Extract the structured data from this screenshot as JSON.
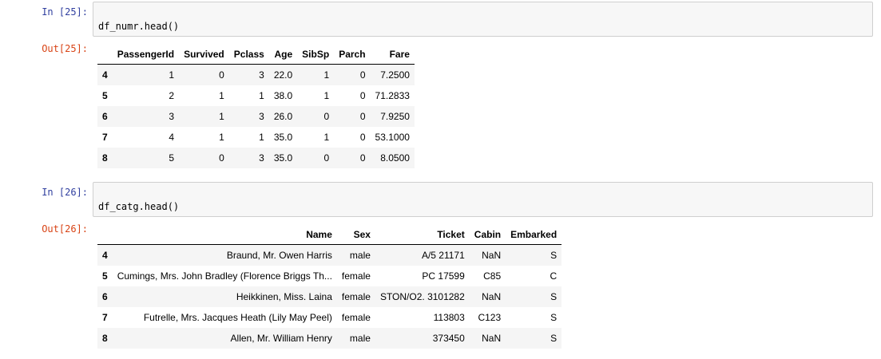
{
  "cells": [
    {
      "in_prompt": "In [25]:",
      "code": "df_numr.head()",
      "out_prompt": "Out[25]:",
      "table": {
        "columns": [
          "",
          "PassengerId",
          "Survived",
          "Pclass",
          "Age",
          "SibSp",
          "Parch",
          "Fare"
        ],
        "rows": [
          [
            "4",
            "1",
            "0",
            "3",
            "22.0",
            "1",
            "0",
            "7.2500"
          ],
          [
            "5",
            "2",
            "1",
            "1",
            "38.0",
            "1",
            "0",
            "71.2833"
          ],
          [
            "6",
            "3",
            "1",
            "3",
            "26.0",
            "0",
            "0",
            "7.9250"
          ],
          [
            "7",
            "4",
            "1",
            "1",
            "35.0",
            "1",
            "0",
            "53.1000"
          ],
          [
            "8",
            "5",
            "0",
            "3",
            "35.0",
            "0",
            "0",
            "8.0500"
          ]
        ]
      }
    },
    {
      "in_prompt": "In [26]:",
      "code": "df_catg.head()",
      "out_prompt": "Out[26]:",
      "table": {
        "columns": [
          "",
          "Name",
          "Sex",
          "Ticket",
          "Cabin",
          "Embarked"
        ],
        "rows": [
          [
            "4",
            "Braund, Mr. Owen Harris",
            "male",
            "A/5 21171",
            "NaN",
            "S"
          ],
          [
            "5",
            "Cumings, Mrs. John Bradley (Florence Briggs Th...",
            "female",
            "PC 17599",
            "C85",
            "C"
          ],
          [
            "6",
            "Heikkinen, Miss. Laina",
            "female",
            "STON/O2. 3101282",
            "NaN",
            "S"
          ],
          [
            "7",
            "Futrelle, Mrs. Jacques Heath (Lily May Peel)",
            "female",
            "113803",
            "C123",
            "S"
          ],
          [
            "8",
            "Allen, Mr. William Henry",
            "male",
            "373450",
            "NaN",
            "S"
          ]
        ]
      }
    }
  ]
}
